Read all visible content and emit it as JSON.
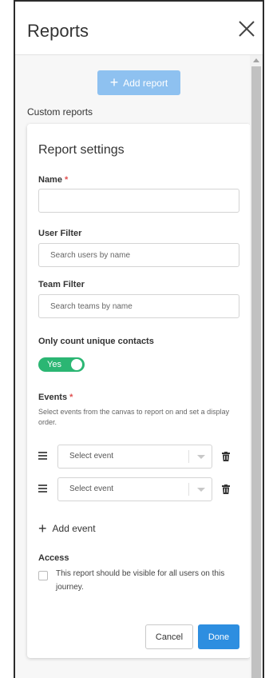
{
  "header": {
    "title": "Reports"
  },
  "toolbar": {
    "add_report_label": "Add report"
  },
  "section": {
    "custom_reports_label": "Custom reports"
  },
  "card": {
    "title": "Report settings",
    "name": {
      "label": "Name",
      "required_mark": "*",
      "value": ""
    },
    "user_filter": {
      "label": "User Filter",
      "placeholder": "Search users by name"
    },
    "team_filter": {
      "label": "Team Filter",
      "placeholder": "Search teams by name"
    },
    "unique_contacts": {
      "label": "Only count unique contacts",
      "toggle_label": "Yes",
      "enabled": true
    },
    "events": {
      "label": "Events",
      "required_mark": "*",
      "help": "Select events from the canvas to report on and set a display order.",
      "rows": [
        {
          "placeholder": "Select event"
        },
        {
          "placeholder": "Select event"
        }
      ],
      "add_label": "Add event"
    },
    "access": {
      "label": "Access",
      "checkbox_label": "This report should be visible for all users on this journey.",
      "checked": false
    },
    "actions": {
      "cancel_label": "Cancel",
      "done_label": "Done"
    }
  },
  "colors": {
    "accent": "#2d8ee0",
    "accent_disabled": "#8ec1f0",
    "toggle_on": "#2bb673",
    "required": "#e05050"
  },
  "icons": {
    "close": "close-icon",
    "plus": "plus-icon",
    "drag": "drag-handle-icon",
    "trash": "trash-icon",
    "caret": "chevron-down-icon"
  }
}
